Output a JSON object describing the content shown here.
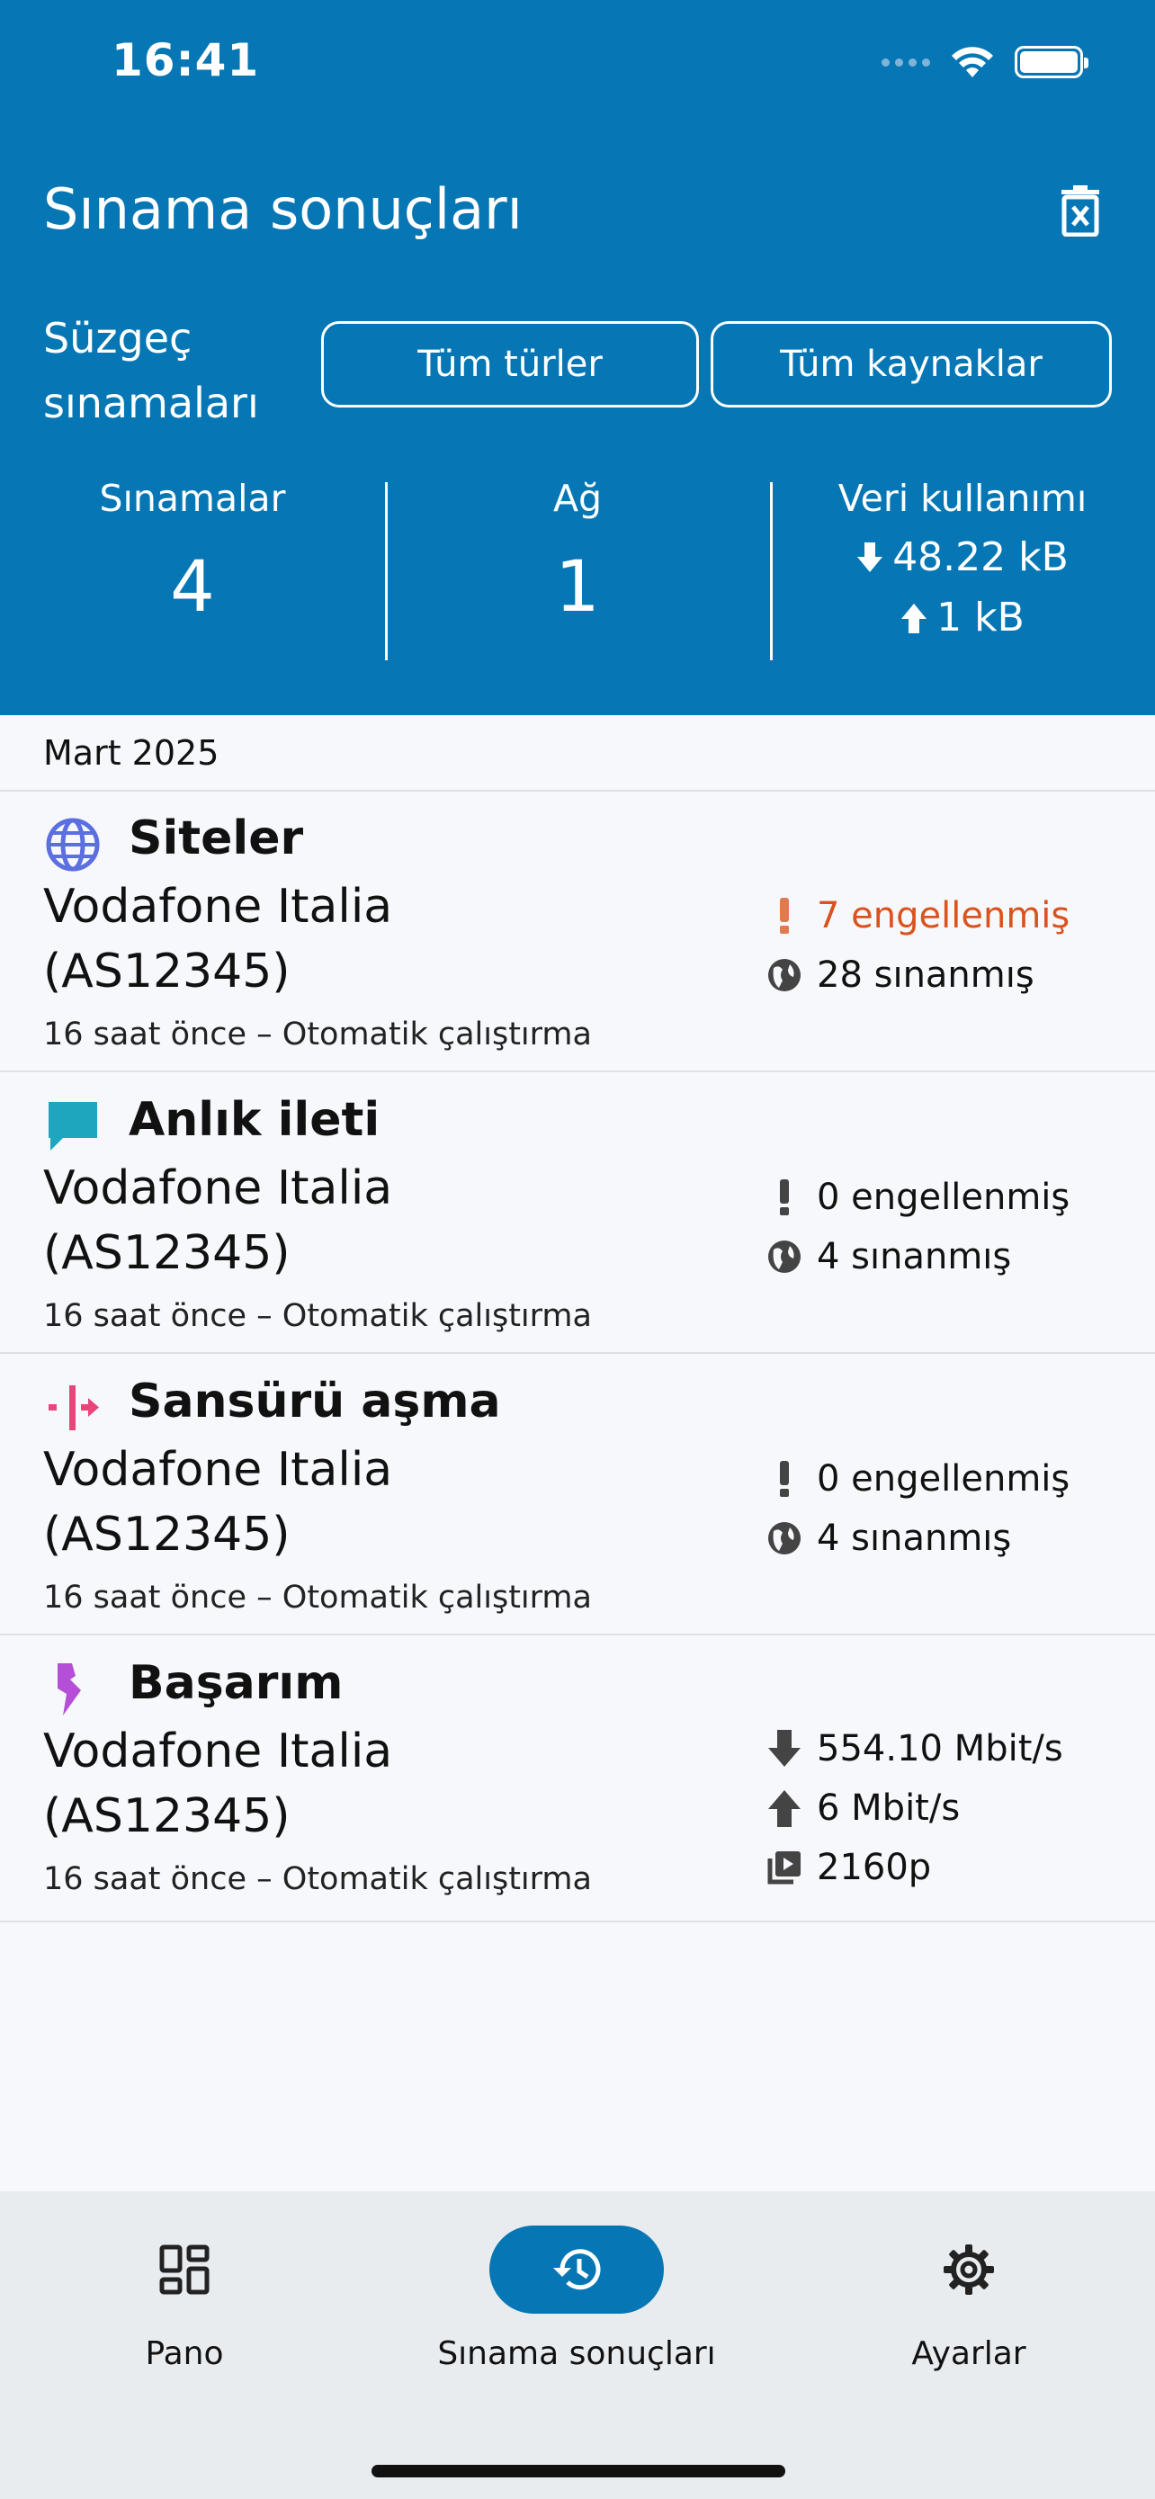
{
  "status_bar": {
    "time": "16:41"
  },
  "header": {
    "title": "Sınama sonuçları",
    "filter_label_line1": "Süzgeç",
    "filter_label_line2": "sınamaları",
    "filter_type_button": "Tüm türler",
    "filter_source_button": "Tüm kaynaklar"
  },
  "stats": {
    "tests_label": "Sınamalar",
    "tests_value": "4",
    "networks_label": "Ağ",
    "networks_value": "1",
    "data_label": "Veri kullanımı",
    "download": "48.22 kB",
    "upload": "1 kB"
  },
  "month": "Mart 2025",
  "results": [
    {
      "title": "Siteler",
      "icon": "globe-icon",
      "network_line1": "Vodafone Italia",
      "network_line2": "(AS12345)",
      "meta": "16 saat önce – Otomatik çalıştırma",
      "blocked": "7 engellenmiş",
      "tested": "28 sınanmış"
    },
    {
      "title": "Anlık ileti",
      "icon": "chat-bubble-icon",
      "network_line1": "Vodafone Italia",
      "network_line2": "(AS12345)",
      "meta": "16 saat önce – Otomatik çalıştırma",
      "blocked": "0 engellenmiş",
      "tested": "4 sınanmış"
    },
    {
      "title": "Sansürü aşma",
      "icon": "circumvention-icon",
      "network_line1": "Vodafone Italia",
      "network_line2": "(AS12345)",
      "meta": "16 saat önce – Otomatik çalıştırma",
      "blocked": "0 engellenmiş",
      "tested": "4 sınanmış"
    },
    {
      "title": "Başarım",
      "icon": "lightning-icon",
      "network_line1": "Vodafone Italia",
      "network_line2": "(AS12345)",
      "meta": "16 saat önce – Otomatik çalıştırma",
      "download": "554.10 Mbit/s",
      "upload": "6 Mbit/s",
      "video": "2160p"
    }
  ],
  "tabs": [
    {
      "label": "Pano",
      "icon": "dashboard-icon"
    },
    {
      "label": "Sınama sonuçları",
      "icon": "history-icon"
    },
    {
      "label": "Ayarlar",
      "icon": "gear-icon"
    }
  ],
  "colors": {
    "header_bg": "#0677b4",
    "blocked_orange": "#d9531e",
    "websites_blue": "#5b6fe0",
    "im_teal": "#1ea6bf",
    "circumvention_pink": "#e8457a",
    "performance_purple": "#b54fd8"
  }
}
